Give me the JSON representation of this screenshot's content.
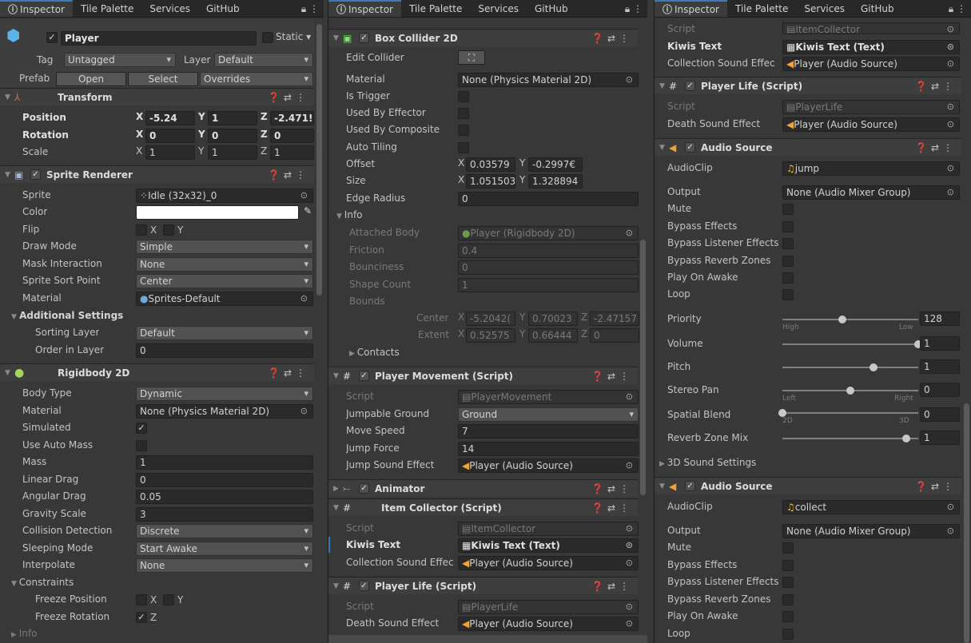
{
  "tabs": [
    "Inspector",
    "Tile Palette",
    "Services",
    "GitHub"
  ],
  "tab_icon": "info-icon",
  "p1": {
    "object_name": "Player",
    "static_label": "Static",
    "tag_label": "Tag",
    "tag_value": "Untagged",
    "layer_label": "Layer",
    "layer_value": "Default",
    "prefab_label": "Prefab",
    "prefab_open": "Open",
    "prefab_select": "Select",
    "prefab_overrides": "Overrides",
    "transform": {
      "title": "Transform",
      "position_label": "Position",
      "rotation_label": "Rotation",
      "scale_label": "Scale",
      "position": [
        "-5.24",
        "1",
        "-2.471!"
      ],
      "rotation": [
        "0",
        "0",
        "0"
      ],
      "scale": [
        "1",
        "1",
        "1"
      ]
    },
    "sprite_renderer": {
      "title": "Sprite Renderer",
      "sprite_label": "Sprite",
      "sprite_value": "Idle (32x32)_0",
      "color_label": "Color",
      "flip_label": "Flip",
      "flip_x": "X",
      "flip_y": "Y",
      "draw_mode_label": "Draw Mode",
      "draw_mode_value": "Simple",
      "mask_label": "Mask Interaction",
      "mask_value": "None",
      "sort_point_label": "Sprite Sort Point",
      "sort_point_value": "Center",
      "material_label": "Material",
      "material_value": "Sprites-Default",
      "additional_label": "Additional Settings",
      "sorting_layer_label": "Sorting Layer",
      "sorting_layer_value": "Default",
      "order_label": "Order in Layer",
      "order_value": "0"
    },
    "rigidbody": {
      "title": "Rigidbody 2D",
      "body_type_label": "Body Type",
      "body_type_value": "Dynamic",
      "material_label": "Material",
      "material_value": "None (Physics Material 2D)",
      "simulated_label": "Simulated",
      "auto_mass_label": "Use Auto Mass",
      "mass_label": "Mass",
      "mass_value": "1",
      "linear_drag_label": "Linear Drag",
      "linear_drag_value": "0",
      "angular_drag_label": "Angular Drag",
      "angular_drag_value": "0.05",
      "gravity_label": "Gravity Scale",
      "gravity_value": "3",
      "collision_label": "Collision Detection",
      "collision_value": "Discrete",
      "sleeping_label": "Sleeping Mode",
      "sleeping_value": "Start Awake",
      "interpolate_label": "Interpolate",
      "interpolate_value": "None",
      "constraints_label": "Constraints",
      "freeze_pos_label": "Freeze Position",
      "freeze_rot_label": "Freeze Rotation",
      "x": "X",
      "y": "Y",
      "z": "Z",
      "info_label": "Info"
    }
  },
  "p2": {
    "box_collider": {
      "title": "Box Collider 2D",
      "edit_label": "Edit Collider",
      "material_label": "Material",
      "material_value": "None (Physics Material 2D)",
      "trigger_label": "Is Trigger",
      "effector_label": "Used By Effector",
      "composite_label": "Used By Composite",
      "tiling_label": "Auto Tiling",
      "offset_label": "Offset",
      "offset_x": "0.03579",
      "offset_y": "-0.2997€",
      "size_label": "Size",
      "size_x": "1.051503",
      "size_y": "1.328894",
      "edge_label": "Edge Radius",
      "edge_value": "0",
      "info_label": "Info",
      "body_label": "Attached Body",
      "body_value": "Player (Rigidbody 2D)",
      "friction_label": "Friction",
      "friction_value": "0.4",
      "bounciness_label": "Bounciness",
      "bounciness_value": "0",
      "shape_label": "Shape Count",
      "shape_value": "1",
      "bounds_label": "Bounds",
      "center_label": "Center",
      "center_x": "-5.2042(",
      "center_y": "0.70023",
      "center_z": "-2.47157",
      "extent_label": "Extent",
      "extent_x": "0.52575",
      "extent_y": "0.66444",
      "extent_z": "0",
      "contacts_label": "Contacts"
    },
    "movement": {
      "title": "Player Movement (Script)",
      "script_label": "Script",
      "script_value": "PlayerMovement",
      "ground_label": "Jumpable Ground",
      "ground_value": "Ground",
      "speed_label": "Move Speed",
      "speed_value": "7",
      "force_label": "Jump Force",
      "force_value": "14",
      "sound_label": "Jump Sound Effect",
      "sound_value": "Player (Audio Source)"
    },
    "animator_title": "Animator",
    "collector": {
      "title": "Item Collector (Script)",
      "script_label": "Script",
      "script_value": "ItemCollector",
      "kiwis_label": "Kiwis Text",
      "kiwis_value": "Kiwis Text (Text)",
      "sound_label": "Collection Sound Effec",
      "sound_value": "Player (Audio Source)"
    },
    "life": {
      "title": "Player Life (Script)",
      "script_label": "Script",
      "script_value": "PlayerLife",
      "death_label": "Death Sound Effect",
      "death_value": "Player (Audio Source)"
    }
  },
  "p3": {
    "collector": {
      "script_label": "Script",
      "script_value": "ItemCollector",
      "kiwis_label": "Kiwis Text",
      "kiwis_value": "Kiwis Text (Text)",
      "sound_label": "Collection Sound Effec",
      "sound_value": "Player (Audio Source)"
    },
    "life": {
      "title": "Player Life (Script)",
      "script_label": "Script",
      "script_value": "PlayerLife",
      "death_label": "Death Sound Effect",
      "death_value": "Player (Audio Source)"
    },
    "audio1": {
      "title": "Audio Source",
      "clip_label": "AudioClip",
      "clip_value": "jump",
      "output_label": "Output",
      "output_value": "None (Audio Mixer Group)",
      "mute_label": "Mute",
      "bypass_fx_label": "Bypass Effects",
      "bypass_listener_label": "Bypass Listener Effects",
      "bypass_reverb_label": "Bypass Reverb Zones",
      "play_awake_label": "Play On Awake",
      "loop_label": "Loop",
      "priority_label": "Priority",
      "priority_value": "128",
      "priority_level": 0.44,
      "high_label": "High",
      "low_label": "Low",
      "volume_label": "Volume",
      "volume_value": "1",
      "volume_level": 1,
      "pitch_label": "Pitch",
      "pitch_value": "1",
      "pitch_level": 0.67,
      "stereo_label": "Stereo Pan",
      "stereo_value": "0",
      "stereo_level": 0.5,
      "left_label": "Left",
      "right_label": "Right",
      "spatial_label": "Spatial Blend",
      "spatial_value": "0",
      "spatial_level": 0,
      "twod_label": "2D",
      "threed_label": "3D",
      "reverb_label": "Reverb Zone Mix",
      "reverb_value": "1",
      "reverb_level": 0.91,
      "settings3d_label": "3D Sound Settings"
    },
    "audio2": {
      "title": "Audio Source",
      "clip_label": "AudioClip",
      "clip_value": "collect",
      "output_label": "Output",
      "output_value": "None (Audio Mixer Group)",
      "mute_label": "Mute",
      "bypass_fx_label": "Bypass Effects",
      "bypass_listener_label": "Bypass Listener Effects",
      "bypass_reverb_label": "Bypass Reverb Zones",
      "play_awake_label": "Play On Awake",
      "loop_label": "Loop"
    }
  },
  "colors": {
    "accent": "#3a79bb",
    "panel": "#383838",
    "field": "#2a2a2a",
    "header": "#3e3e3e"
  }
}
